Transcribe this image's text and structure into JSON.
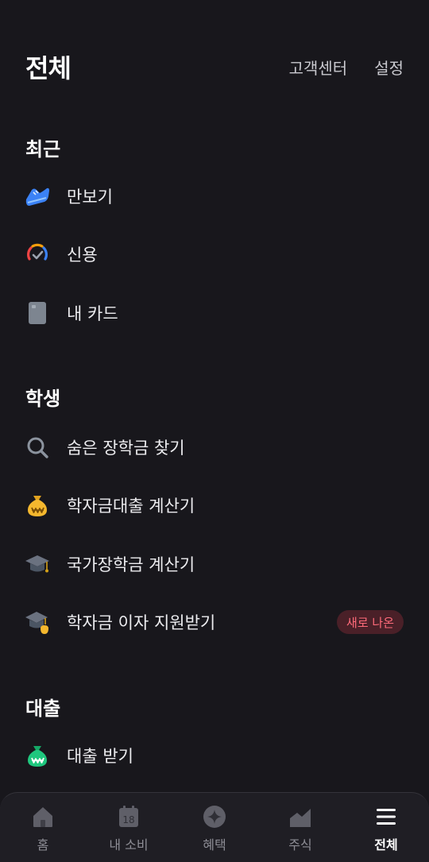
{
  "header": {
    "title": "전체",
    "links": [
      "고객센터",
      "설정"
    ]
  },
  "sections": [
    {
      "title": "최근",
      "items": [
        {
          "label": "만보기",
          "icon": "sneaker-icon"
        },
        {
          "label": "신용",
          "icon": "credit-gauge-icon"
        },
        {
          "label": "내 카드",
          "icon": "card-icon"
        }
      ]
    },
    {
      "title": "학생",
      "items": [
        {
          "label": "숨은 장학금 찾기",
          "icon": "search-icon"
        },
        {
          "label": "학자금대출 계산기",
          "icon": "money-bag-icon"
        },
        {
          "label": "국가장학금 계산기",
          "icon": "graduation-cap-icon"
        },
        {
          "label": "학자금 이자 지원받기",
          "icon": "graduation-cap-coin-icon",
          "badge": "새로 나온"
        }
      ]
    },
    {
      "title": "대출",
      "items": [
        {
          "label": "대출 받기",
          "icon": "loan-bag-icon"
        }
      ]
    }
  ],
  "tabbar": {
    "tabs": [
      {
        "label": "홈",
        "icon": "home-icon"
      },
      {
        "label": "내 소비",
        "icon": "calendar-icon",
        "icon_text": "18"
      },
      {
        "label": "혜택",
        "icon": "benefit-star-icon"
      },
      {
        "label": "주식",
        "icon": "stock-chart-icon"
      },
      {
        "label": "전체",
        "icon": "menu-icon",
        "active": true
      }
    ]
  },
  "colors": {
    "background": "#18171c",
    "text": "#ececef",
    "badge_bg": "#4a2028",
    "badge_text": "#ff6b7a",
    "sneaker": "#3b82f6",
    "money_bag": "#f5b82e",
    "loan_bag": "#1fc77e"
  }
}
